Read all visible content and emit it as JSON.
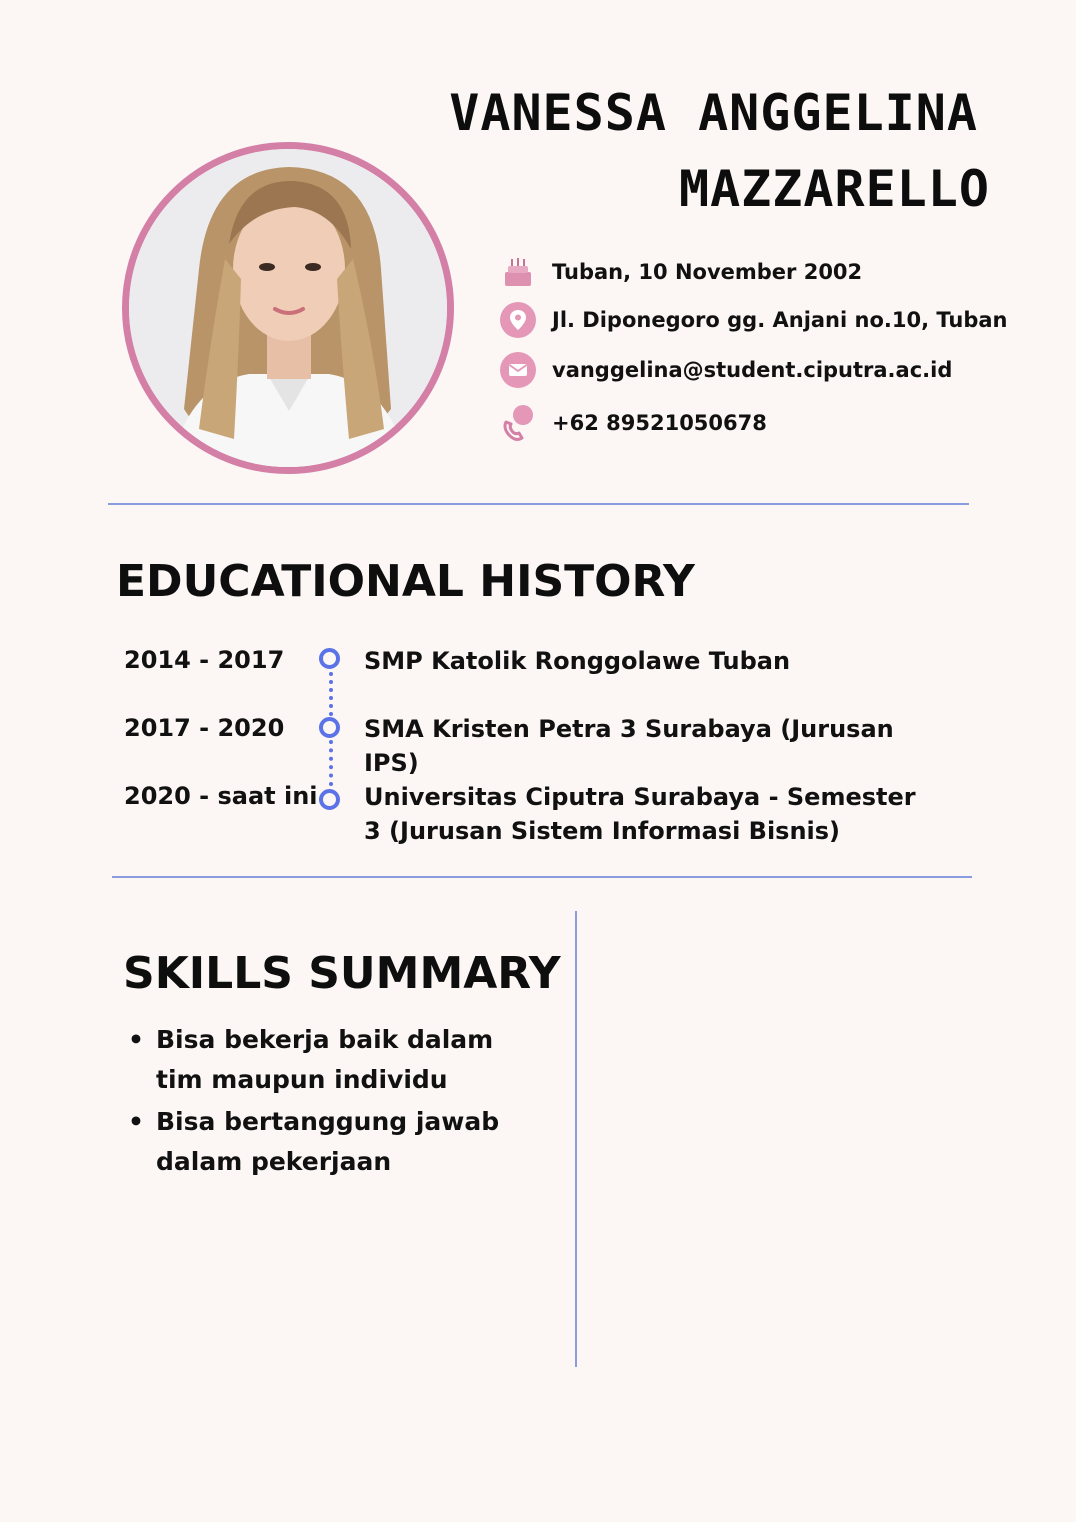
{
  "name": {
    "line1": "VANESSA ANGGELINA",
    "line2": "MAZZARELLO"
  },
  "contact": {
    "birth": "Tuban, 10 November 2002",
    "address": "Jl. Diponegoro gg. Anjani no.10, Tuban",
    "email": "vanggelina@student.ciputra.ac.id",
    "phone": "+62 89521050678"
  },
  "education": {
    "title": "EDUCATIONAL HISTORY",
    "items": [
      {
        "years": "2014 - 2017",
        "school": "SMP Katolik Ronggolawe Tuban"
      },
      {
        "years": "2017 - 2020",
        "school": "SMA Kristen Petra 3 Surabaya (Jurusan IPS)"
      },
      {
        "years": "2020 - saat ini",
        "school": "Universitas Ciputra Surabaya - Semester 3 (Jurusan Sistem Informasi Bisnis)"
      }
    ]
  },
  "skills": {
    "title": "SKILLS SUMMARY",
    "items": [
      "Bisa bekerja baik dalam tim maupun individu",
      "Bisa bertanggung jawab dalam pekerjaan"
    ]
  },
  "colors": {
    "accent_pink": "#d47fa6",
    "accent_blue": "#5a73e6",
    "background": "#fcf6f5"
  },
  "icons": [
    "cake-icon",
    "location-pin-icon",
    "mail-icon",
    "phone-icon"
  ]
}
